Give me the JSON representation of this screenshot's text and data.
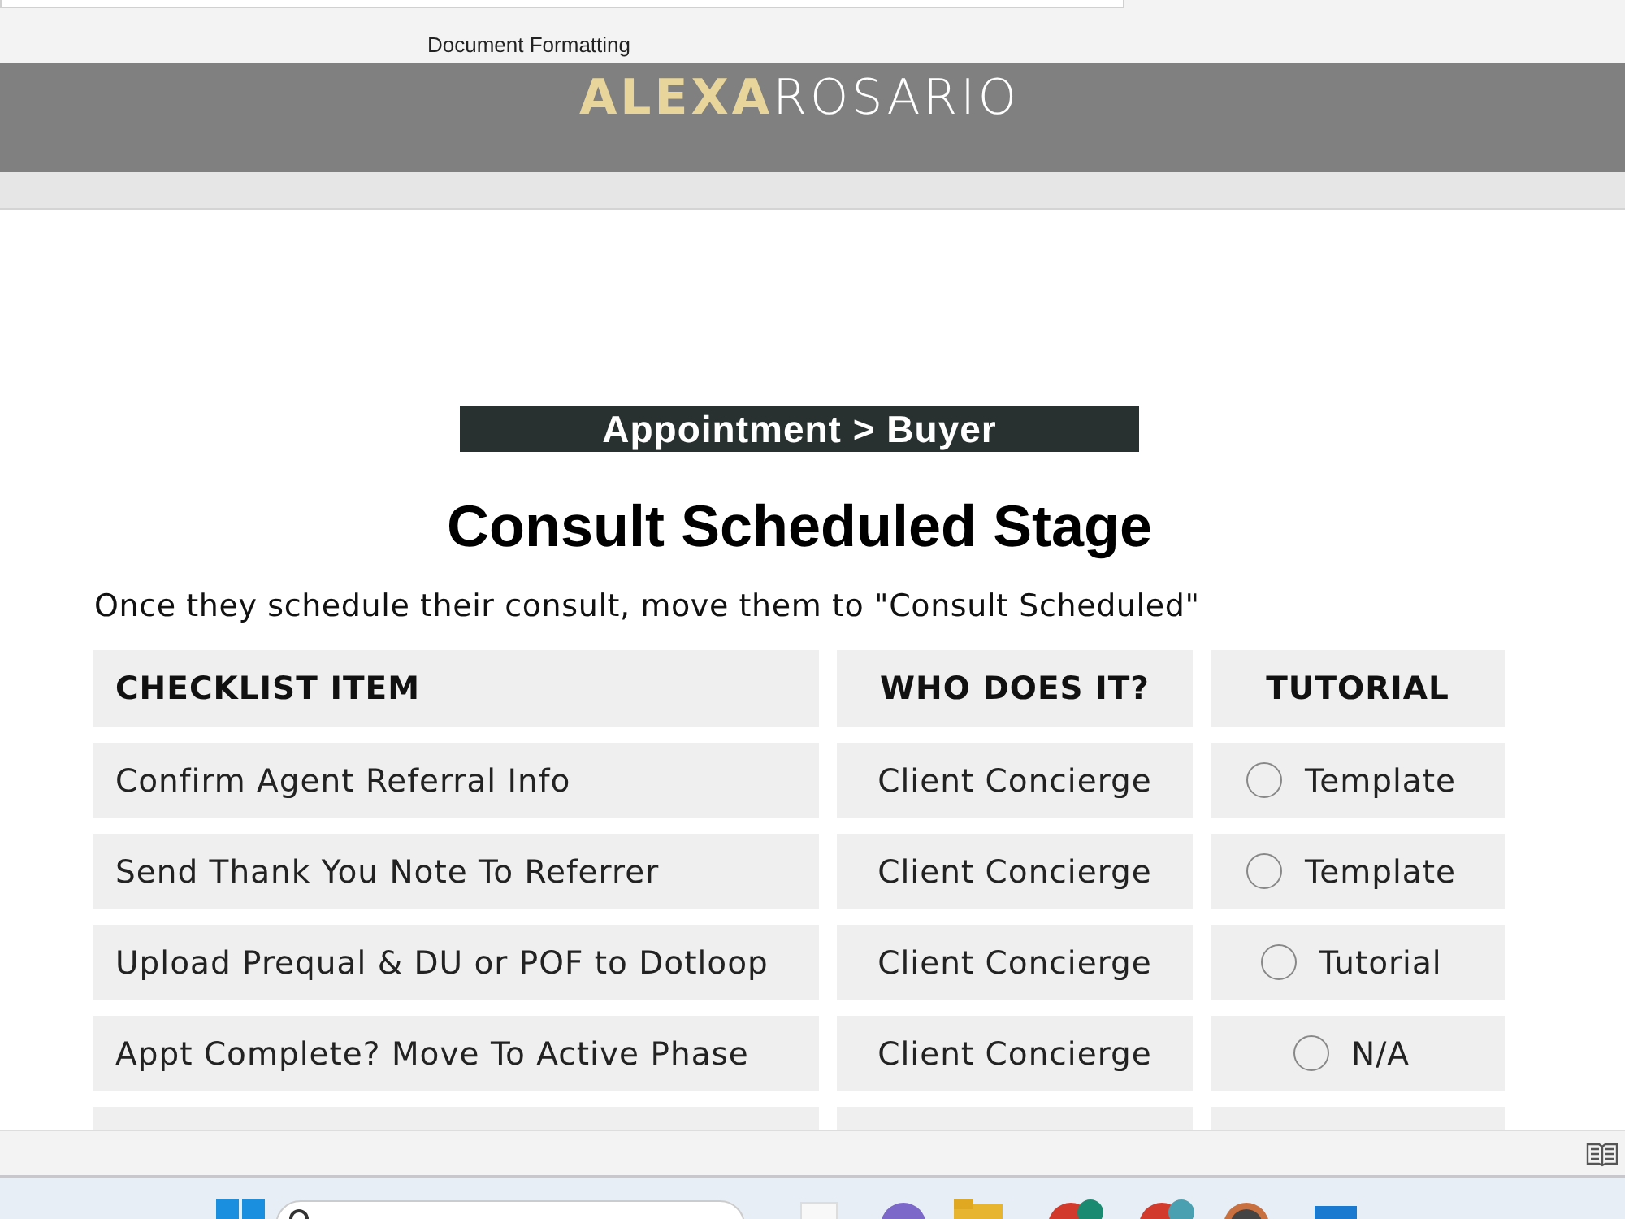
{
  "ribbon": {
    "group_label": "Document Formatting"
  },
  "banner": {
    "logo_first": "ALEXA",
    "logo_last": "ROSARIO"
  },
  "document": {
    "section_label": "Appointment > Buyer",
    "title": "Consult Scheduled Stage",
    "instruction": "Once they schedule their consult, move them to \"Consult Scheduled\"",
    "table": {
      "columns": [
        "CHECKLIST ITEM",
        "WHO DOES IT?",
        "TUTORIAL"
      ],
      "rows": [
        {
          "item": "Confirm Agent Referral Info",
          "who": "Client Concierge",
          "tutorial": "Template",
          "checked": false
        },
        {
          "item": "Send Thank You Note To Referrer",
          "who": "Client Concierge",
          "tutorial": "Template",
          "checked": false
        },
        {
          "item": "Upload Prequal & DU or POF to Dotloop",
          "who": "Client Concierge",
          "tutorial": "Tutorial",
          "checked": false
        },
        {
          "item": "Appt Complete? Move To Active Phase",
          "who": "Client Concierge",
          "tutorial": "N/A",
          "checked": false
        }
      ]
    }
  }
}
